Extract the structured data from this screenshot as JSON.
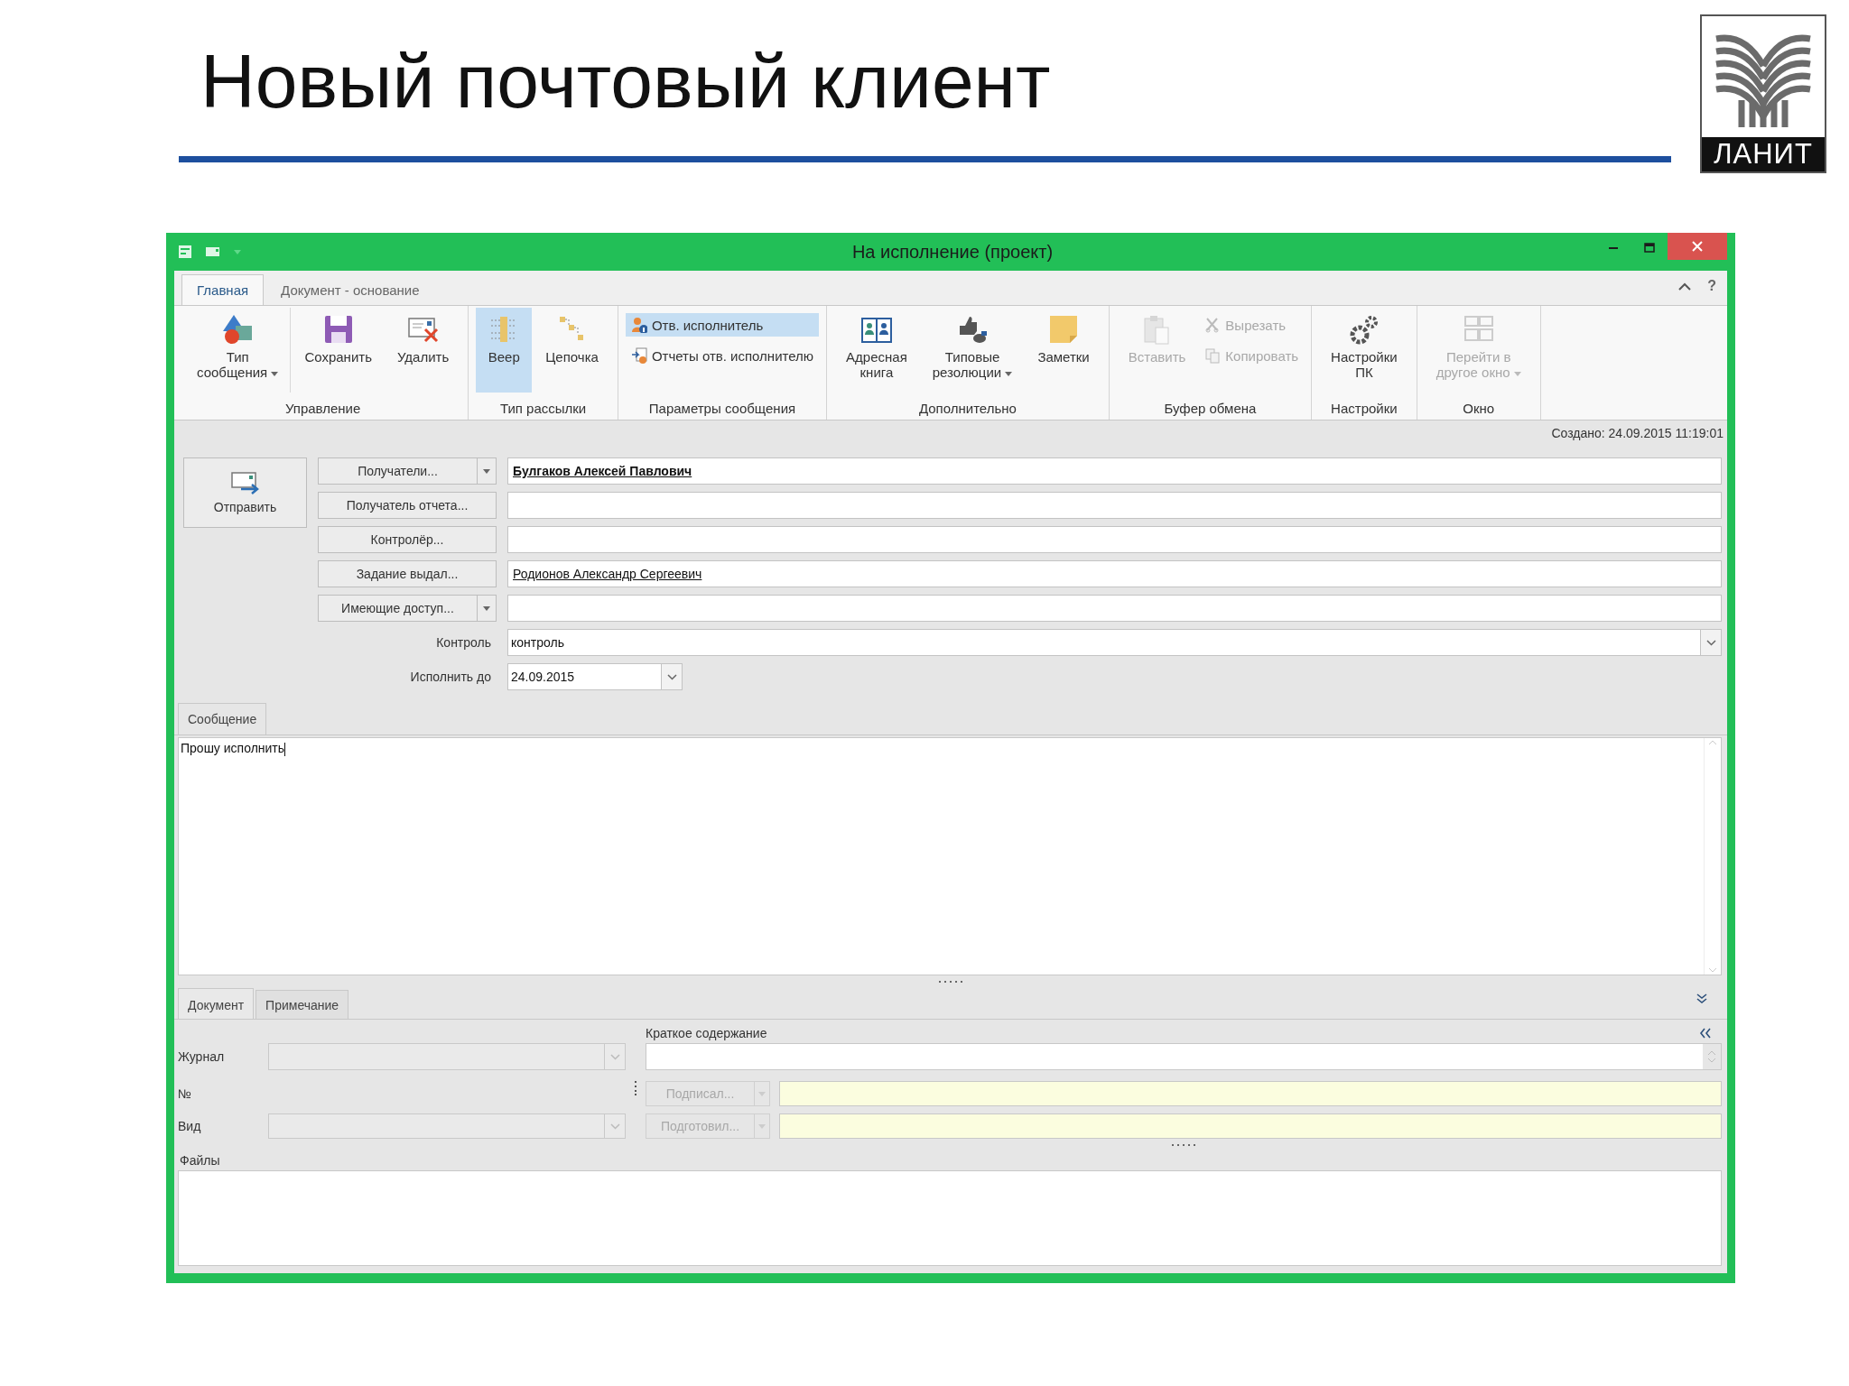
{
  "slide": {
    "title": "Новый почтовый клиент",
    "logo_text": "ЛАНИТ"
  },
  "window": {
    "title": "На исполнение (проект)"
  },
  "ribbon": {
    "tabs": [
      {
        "label": "Главная",
        "selected": true
      },
      {
        "label": "Документ - основание",
        "selected": false
      }
    ],
    "help": "?",
    "groups": [
      {
        "label": "Управление",
        "items": [
          {
            "kind": "large",
            "lines": [
              "Тип",
              "сообщения"
            ],
            "dropdown": true,
            "disabled": false,
            "selected": false
          },
          {
            "kind": "large",
            "lines": [
              "Сохранить"
            ],
            "dropdown": false,
            "disabled": false,
            "selected": false
          },
          {
            "kind": "large",
            "lines": [
              "Удалить"
            ],
            "dropdown": false,
            "disabled": false,
            "selected": false
          }
        ]
      },
      {
        "label": "Тип рассылки",
        "items": [
          {
            "kind": "large",
            "lines": [
              "Веер"
            ],
            "dropdown": false,
            "disabled": false,
            "selected": true
          },
          {
            "kind": "large",
            "lines": [
              "Цепочка"
            ],
            "dropdown": false,
            "disabled": false,
            "selected": false
          }
        ]
      },
      {
        "label": "Параметры сообщения",
        "items": [
          {
            "kind": "small",
            "lines": [
              "Отв. исполнитель"
            ],
            "dropdown": false,
            "disabled": false,
            "selected": true
          },
          {
            "kind": "small",
            "lines": [
              "Отчеты отв. исполнителю"
            ],
            "dropdown": false,
            "disabled": false,
            "selected": false
          }
        ]
      },
      {
        "label": "Дополнительно",
        "items": [
          {
            "kind": "large",
            "lines": [
              "Адресная",
              "книга"
            ],
            "dropdown": false,
            "disabled": false,
            "selected": false
          },
          {
            "kind": "large",
            "lines": [
              "Типовые",
              "резолюции"
            ],
            "dropdown": true,
            "disabled": false,
            "selected": false
          },
          {
            "kind": "large",
            "lines": [
              "Заметки"
            ],
            "dropdown": false,
            "disabled": false,
            "selected": false
          }
        ]
      },
      {
        "label": "Буфер обмена",
        "items": [
          {
            "kind": "large",
            "lines": [
              "Вставить"
            ],
            "dropdown": false,
            "disabled": true,
            "selected": false
          },
          {
            "kind": "small",
            "lines": [
              "Вырезать"
            ],
            "dropdown": false,
            "disabled": true,
            "selected": false
          },
          {
            "kind": "small",
            "lines": [
              "Копировать"
            ],
            "dropdown": false,
            "disabled": true,
            "selected": false
          }
        ]
      },
      {
        "label": "Настройки",
        "items": [
          {
            "kind": "large",
            "lines": [
              "Настройки",
              "ПК"
            ],
            "dropdown": false,
            "disabled": false,
            "selected": false
          }
        ]
      },
      {
        "label": "Окно",
        "items": [
          {
            "kind": "large",
            "lines": [
              "Перейти в",
              "другое окно"
            ],
            "dropdown": true,
            "disabled": true,
            "selected": false
          }
        ]
      }
    ]
  },
  "created": "Создано: 24.09.2015 11:19:01",
  "send_button": "Отправить",
  "recipients": [
    {
      "button": "Получатели...",
      "dropdown": true,
      "value": "Булгаков Алексей Павлович",
      "bold": true
    },
    {
      "button": "Получатель отчета...",
      "dropdown": false
    },
    {
      "button": "Контролёр...",
      "dropdown": false
    },
    {
      "button": "Задание выдал...",
      "dropdown": false,
      "value": "Родионов Александр Сергеевич",
      "bold": false
    },
    {
      "button": "Имеющие доступ...",
      "dropdown": true
    }
  ],
  "control": {
    "label": "Контроль",
    "value": "контроль"
  },
  "due": {
    "label": "Исполнить до",
    "value": "24.09.2015"
  },
  "message_tab": {
    "label": "Сообщение"
  },
  "message": {
    "value": "Прошу исполнить"
  },
  "bottom_tabs": [
    {
      "label": "Документ",
      "selected": true
    },
    {
      "label": "Примечание",
      "selected": false
    }
  ],
  "document": {
    "journal_label": "Журнал",
    "number_label": "№",
    "kind_label": "Вид",
    "summary_label": "Краткое содержание",
    "signed": {
      "button": "Подписал...",
      "disabled": true
    },
    "prepared": {
      "button": "Подготовил...",
      "disabled": true
    },
    "files_label": "Файлы"
  }
}
